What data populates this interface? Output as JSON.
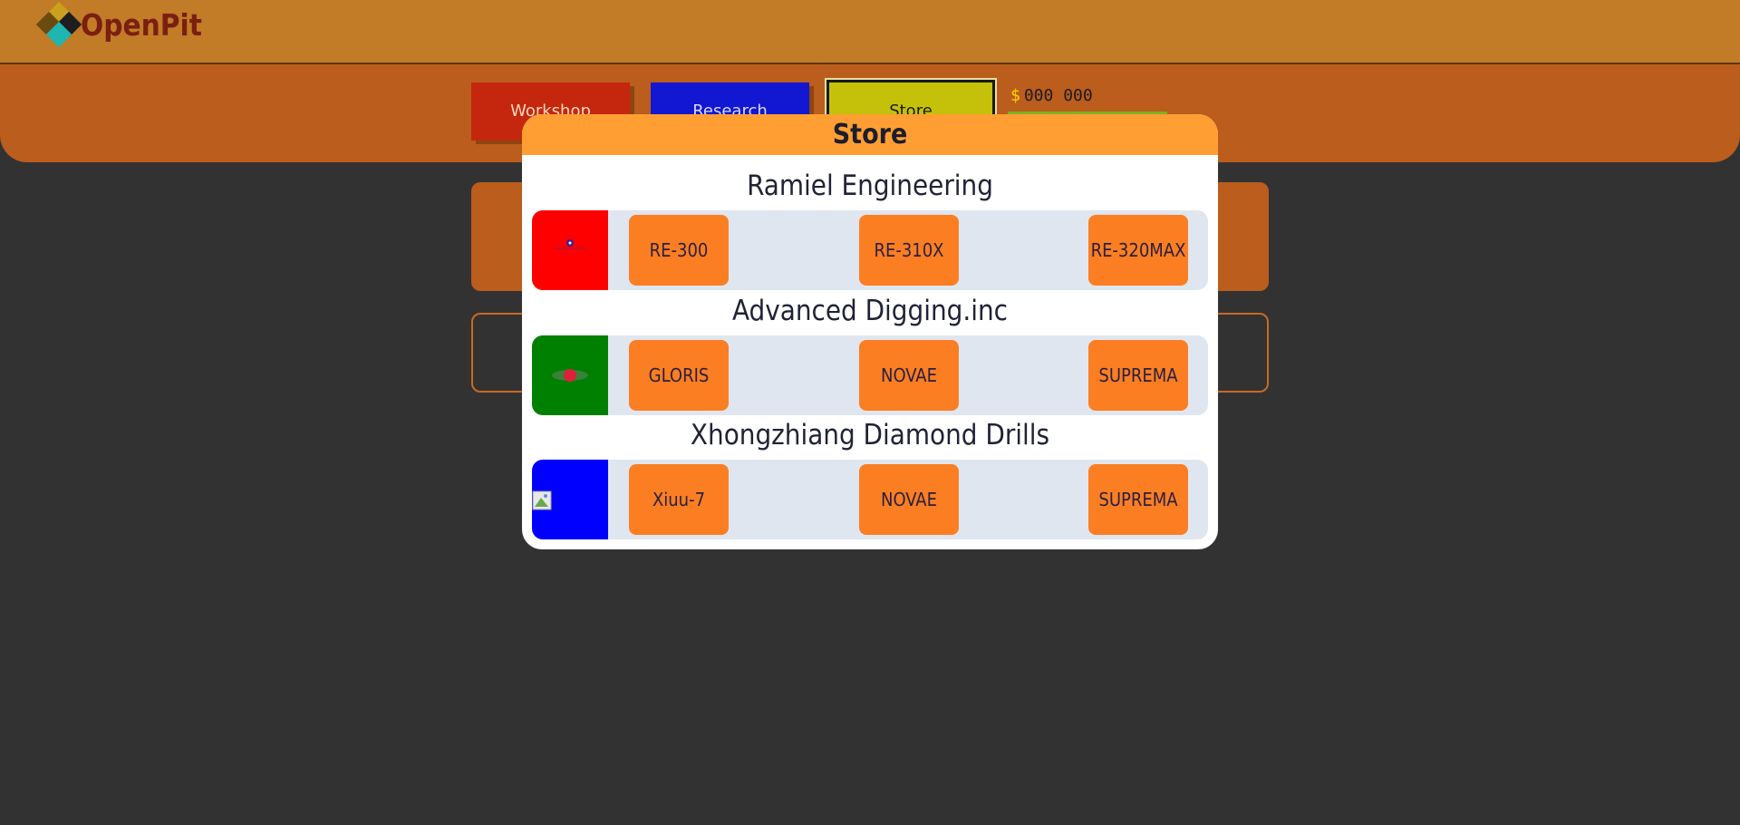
{
  "app": {
    "name": "OpenPit"
  },
  "nav": {
    "workshop_label": "Workshop",
    "research_label": "Research",
    "store_label": "Store",
    "money_symbol": "$",
    "money_value": "000 000"
  },
  "store": {
    "title": "Store",
    "companies": [
      {
        "name": "Ramiel Engineering",
        "tile_color": "#ff0000",
        "drills": [
          "RE-300",
          "RE-310X",
          "RE-320MAX"
        ]
      },
      {
        "name": "Advanced Digging.inc",
        "tile_color": "#008000",
        "drills": [
          "GLORIS",
          "NOVAE",
          "SUPREMA"
        ]
      },
      {
        "name": "Xhongzhiang Diamond Drills",
        "tile_color": "#0000ff",
        "drills": [
          "Xiuu-7",
          "NOVAE",
          "SUPREMA"
        ]
      }
    ]
  },
  "colors": {
    "topbar": "#c27b26",
    "navbar": "#bb5d1d",
    "modal_header": "#ff9f33",
    "drill_button": "#fb7e23",
    "background": "#333233"
  }
}
